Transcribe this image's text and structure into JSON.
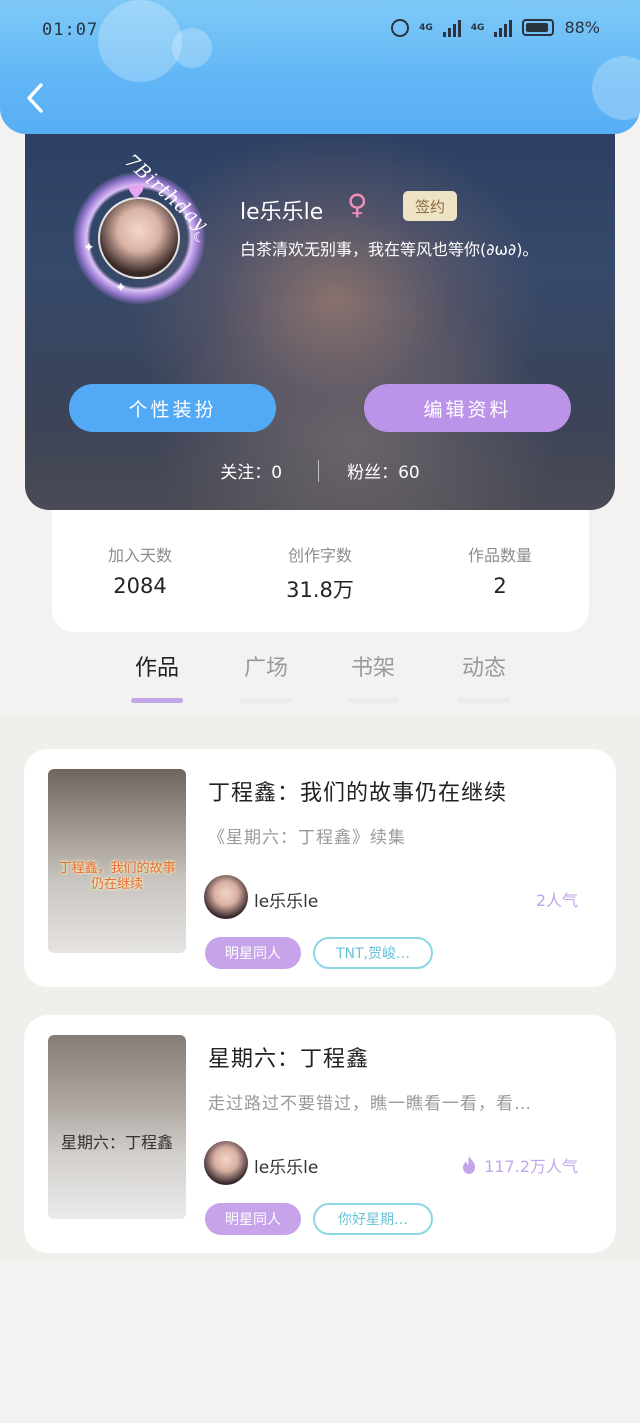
{
  "status_bar": {
    "time": "01:07",
    "network_1": "4G",
    "network_2": "4G",
    "battery": "88%"
  },
  "header": {
    "back_icon": "chevron-left-icon"
  },
  "profile": {
    "avatar_frame_text": "7Birthday",
    "username": "le乐乐le",
    "gender_symbol": "♀",
    "badge": "签约",
    "bio": "白茶清欢无别事，我在等风也等你(∂ω∂)。",
    "buttons": {
      "style_label": "个性装扮",
      "edit_label": "编辑资料"
    },
    "following": "关注：0",
    "followers": "粉丝：60"
  },
  "stats": [
    {
      "label": "加入天数",
      "value": "2084"
    },
    {
      "label": "创作字数",
      "value": "31.8万"
    },
    {
      "label": "作品数量",
      "value": "2"
    }
  ],
  "tabs": [
    {
      "label": "作品",
      "active": true
    },
    {
      "label": "广场",
      "active": false
    },
    {
      "label": "书架",
      "active": false
    },
    {
      "label": "动态",
      "active": false
    }
  ],
  "works": [
    {
      "cover_caption": "丁程鑫，我们的故事仍在继续",
      "title": "丁程鑫：我们的故事仍在继续",
      "description": "《星期六：丁程鑫》续集",
      "author": "le乐乐le",
      "popularity": "2人气",
      "tags": [
        "明星同人",
        "TNT,贺峻…"
      ]
    },
    {
      "cover_caption": "星期六：丁程鑫",
      "title": "星期六：丁程鑫",
      "description": "走过路过不要错过，瞧一瞧看一看，看…",
      "author": "le乐乐le",
      "popularity": "117.2万人气",
      "popularity_icon": "fire-icon",
      "tags": [
        "明星同人",
        "你好星期…"
      ]
    }
  ],
  "colors": {
    "header_blue": "#60b6f6",
    "accent_purple": "#bb94ea",
    "accent_blue": "#52a9f6",
    "tag_outline": "#8cd6e6"
  }
}
